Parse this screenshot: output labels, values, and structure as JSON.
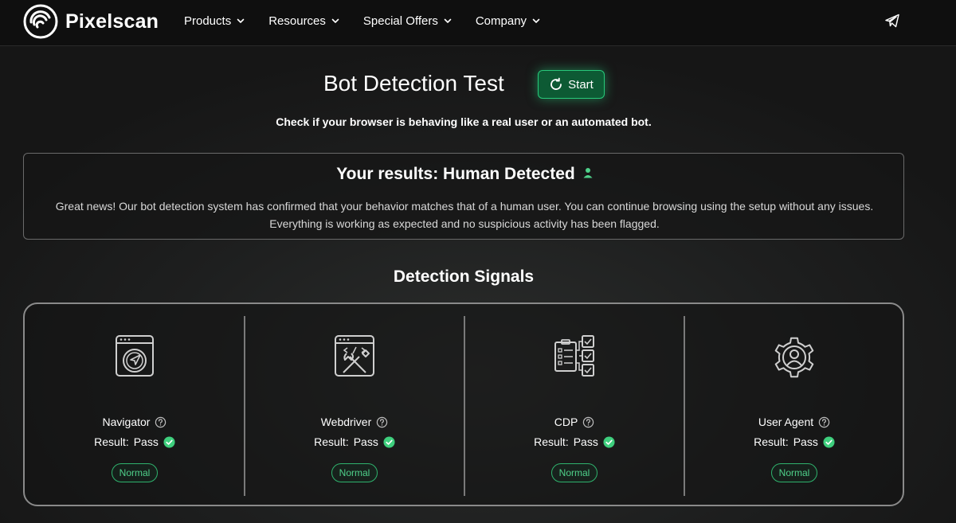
{
  "nav": {
    "brand": "Pixelscan",
    "items": [
      {
        "label": "Products"
      },
      {
        "label": "Resources"
      },
      {
        "label": "Special Offers"
      },
      {
        "label": "Company"
      }
    ],
    "right_icon": "telegram-icon"
  },
  "hero": {
    "title": "Bot Detection Test",
    "start_label": "Start",
    "subtitle": "Check if your browser is behaving like a real user or an automated bot."
  },
  "results": {
    "title": "Your results: Human Detected",
    "text": "Great news! Our bot detection system has confirmed that your behavior matches that of a human user. You can continue browsing using the setup without any issues. Everything is working as expected and no suspicious activity has been flagged."
  },
  "signals": {
    "title": "Detection Signals",
    "cards": [
      {
        "name": "Navigator",
        "result_label": "Result:",
        "result": "Pass",
        "badge": "Normal",
        "icon": "navigator-icon"
      },
      {
        "name": "Webdriver",
        "result_label": "Result:",
        "result": "Pass",
        "badge": "Normal",
        "icon": "webdriver-icon"
      },
      {
        "name": "CDP",
        "result_label": "Result:",
        "result": "Pass",
        "badge": "Normal",
        "icon": "cdp-icon"
      },
      {
        "name": "User Agent",
        "result_label": "Result:",
        "result": "Pass",
        "badge": "Normal",
        "icon": "user-agent-icon"
      }
    ]
  },
  "colors": {
    "accent_green": "#27c97a",
    "badge_green": "#4fd18a",
    "background": "#161616"
  }
}
